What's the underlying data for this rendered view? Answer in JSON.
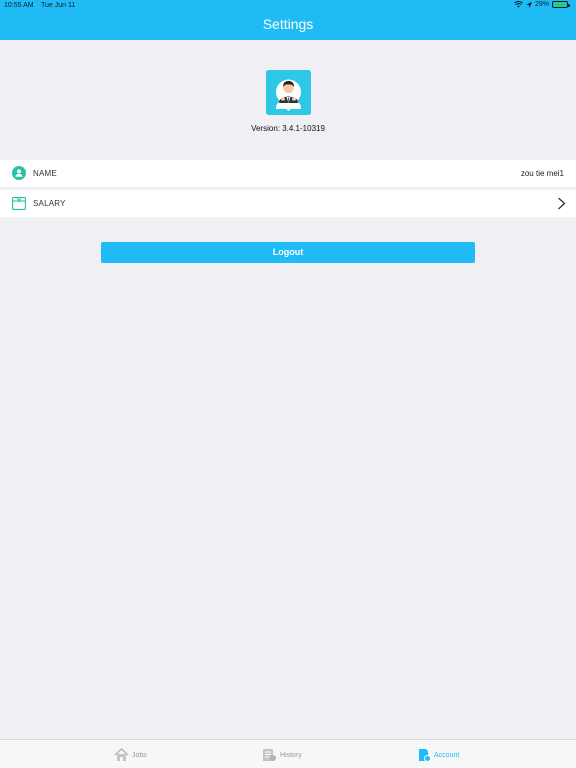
{
  "status_bar": {
    "time": "10:55 AM",
    "date": "Tue Jun 11",
    "battery": "29%",
    "icons": [
      "wifi-icon",
      "location-icon",
      "battery-icon"
    ]
  },
  "header": {
    "title": "Settings"
  },
  "app": {
    "logo_icon": "app-logo-icon",
    "version": "Version: 3.4.1-10319"
  },
  "settings": {
    "name": {
      "label": "NAME",
      "value": "zou tie mei1",
      "icon": "person-icon"
    },
    "salary": {
      "label": "SALARY",
      "icon": "salary-icon"
    }
  },
  "logout": {
    "label": "Logout"
  },
  "tabbar": {
    "tabs": [
      {
        "label": "Jobs",
        "icon": "home-icon"
      },
      {
        "label": "History",
        "icon": "history-icon"
      },
      {
        "label": "Account",
        "icon": "account-icon",
        "selected": true
      }
    ]
  },
  "colors": {
    "accent": "#1ebbf5",
    "background": "#efeff4",
    "teal": "#26c2a6"
  }
}
